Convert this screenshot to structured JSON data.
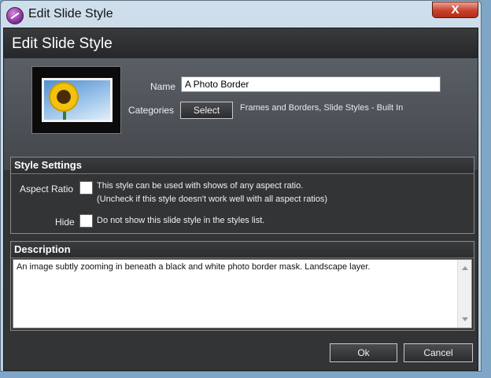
{
  "window": {
    "title": "Edit Slide Style",
    "close_label": "X"
  },
  "dialog": {
    "title": "Edit Slide Style",
    "name_label": "Name",
    "name_value": "A Photo Border",
    "categories_label": "Categories",
    "select_label": "Select",
    "categories_value": "Frames and Borders, Slide Styles - Built In"
  },
  "style_settings": {
    "title": "Style Settings",
    "aspect_ratio_label": "Aspect Ratio",
    "aspect_ratio_line1": "This style can be used with shows of any aspect ratio.",
    "aspect_ratio_line2": "(Uncheck if this style doesn't work well with all aspect ratios)",
    "hide_label": "Hide",
    "hide_text": "Do not show this slide style in the styles list."
  },
  "description": {
    "title": "Description",
    "text": "An image subtly zooming in beneath a black and white photo border mask.  Landscape layer."
  },
  "buttons": {
    "ok": "Ok",
    "cancel": "Cancel"
  }
}
